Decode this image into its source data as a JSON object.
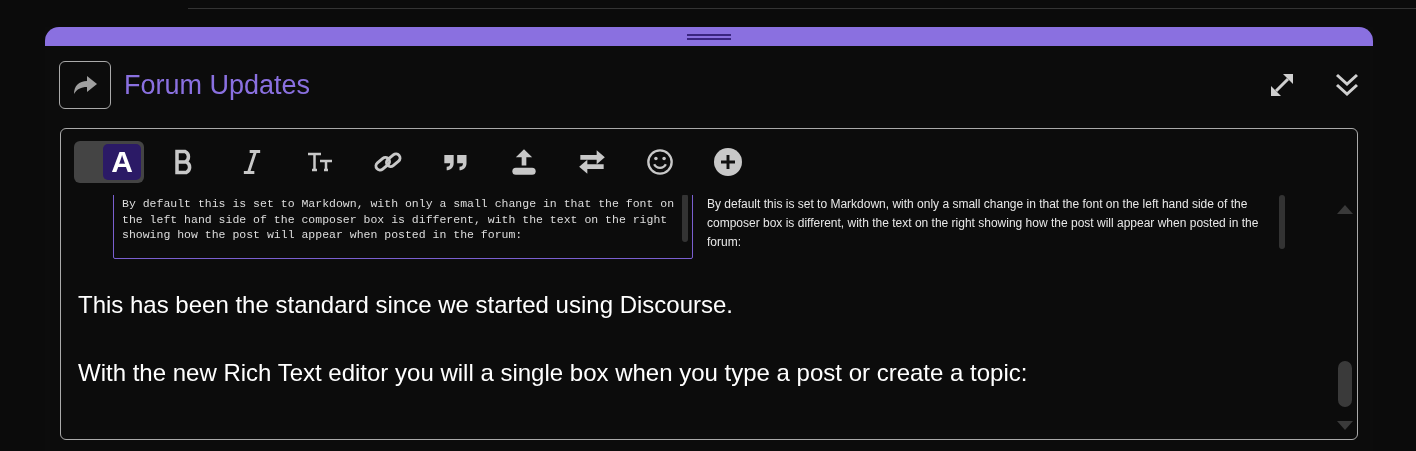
{
  "panel": {
    "title": "Forum Updates"
  },
  "toolbar": {
    "rich_text_toggle": {
      "on": true,
      "label": "A"
    }
  },
  "embedded_screenshot": {
    "markdown_text": "By default this is set to Markdown, with only a small change in that the font on the left hand side of the composer box is different, with the text on the right showing how the post will appear when posted in the forum:",
    "preview_text": "By default this is set to Markdown, with only a small change in that the font on the left hand side of the composer box is different, with the text on the right showing how the post will appear when posted in the forum:"
  },
  "paragraphs": [
    "This has been the standard since we started using Discourse.",
    "With the new Rich Text editor you will a single box when you type a post or create a topic:"
  ]
}
